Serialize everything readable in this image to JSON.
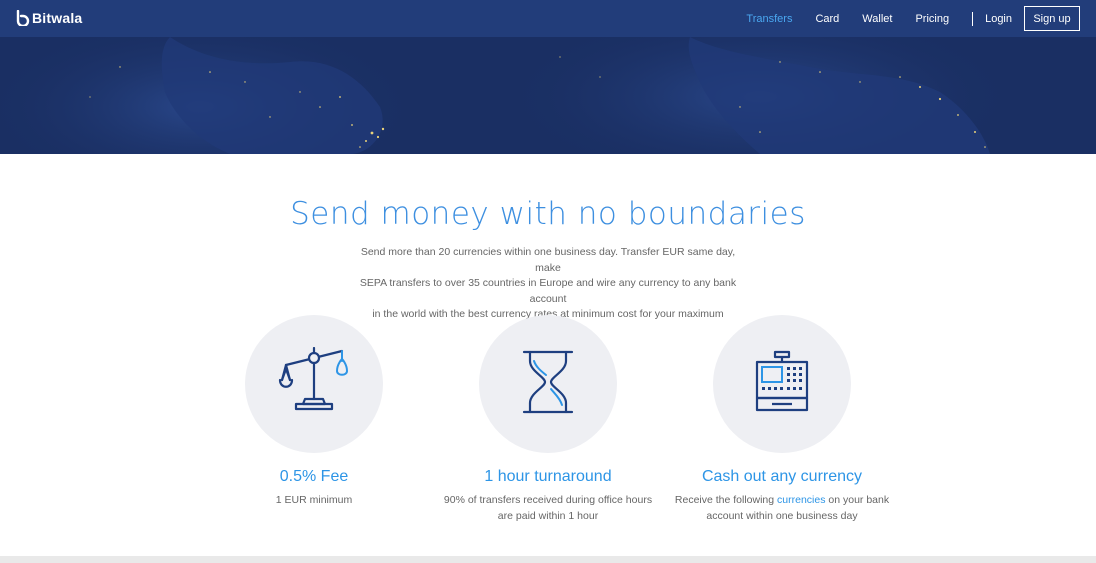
{
  "header": {
    "brand": "Bitwala",
    "nav": [
      {
        "label": "Transfers",
        "active": true
      },
      {
        "label": "Card",
        "active": false
      },
      {
        "label": "Wallet",
        "active": false
      },
      {
        "label": "Pricing",
        "active": false
      }
    ],
    "login_label": "Login",
    "signup_label": "Sign up"
  },
  "main": {
    "title": "Send money with no boundaries",
    "intro_lines": [
      "Send more than 20 currencies within one business day. Transfer EUR same day, make",
      "SEPA transfers to over 35 countries in Europe and wire any currency to any bank account",
      "in the world with the best currency rates at minimum cost for your maximum convenience"
    ]
  },
  "features": [
    {
      "icon": "balance-scale-icon",
      "title": "0.5% Fee",
      "desc_lines": [
        "1 EUR minimum"
      ]
    },
    {
      "icon": "hourglass-icon",
      "title": "1 hour turnaround",
      "desc_lines": [
        "90% of transfers received during office hours",
        "are paid within 1 hour"
      ]
    },
    {
      "icon": "cash-register-icon",
      "title": "Cash out any currency",
      "desc_prefix": "Receive the following ",
      "desc_link": "currencies",
      "desc_suffix": " on your bank",
      "desc_line2": "account within one business day"
    }
  ],
  "colors": {
    "navbar": "#223d7a",
    "hero": "#1a2f63",
    "accent": "#2d95e6",
    "active_nav": "#4aa7f0",
    "circle": "#eeeff3"
  }
}
